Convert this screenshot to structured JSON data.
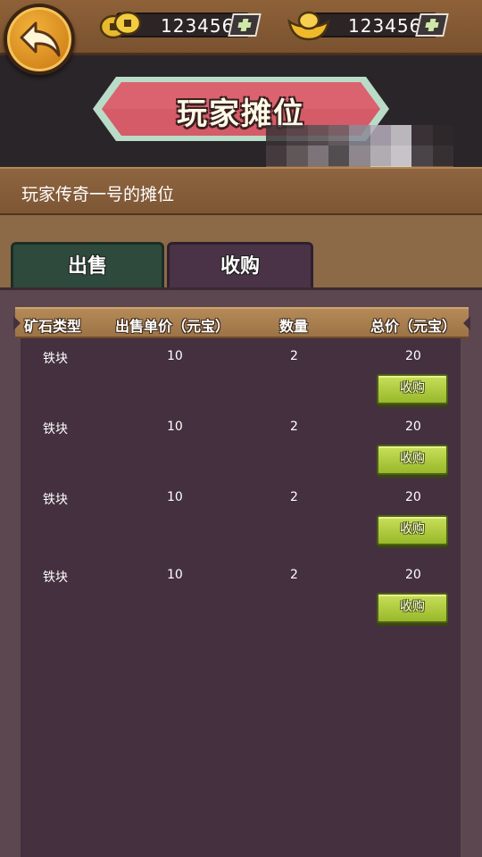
{
  "topbar": {
    "coins": {
      "amount": "123456"
    },
    "ingots": {
      "amount": "123456"
    }
  },
  "banner": {
    "title": "玩家摊位"
  },
  "stall": {
    "name": "玩家传奇一号的摊位"
  },
  "tabs": {
    "sell": "出售",
    "buy": "收购"
  },
  "table": {
    "headers": {
      "type": "矿石类型",
      "unit_price": "出售单价（元宝）",
      "quantity": "数量",
      "total": "总价（元宝）"
    },
    "rows": [
      {
        "type": "铁块",
        "unit_price": "10",
        "quantity": "2",
        "total": "20",
        "action": "收购"
      },
      {
        "type": "铁块",
        "unit_price": "10",
        "quantity": "2",
        "total": "20",
        "action": "收购"
      },
      {
        "type": "铁块",
        "unit_price": "10",
        "quantity": "2",
        "total": "20",
        "action": "收购"
      },
      {
        "type": "铁块",
        "unit_price": "10",
        "quantity": "2",
        "total": "20",
        "action": "收购"
      }
    ]
  },
  "colors": {
    "sell_tab": "#2e4a3d",
    "buy_tab": "#4a3346",
    "panel": "#44303f",
    "buy_button": "#b5cf45"
  }
}
